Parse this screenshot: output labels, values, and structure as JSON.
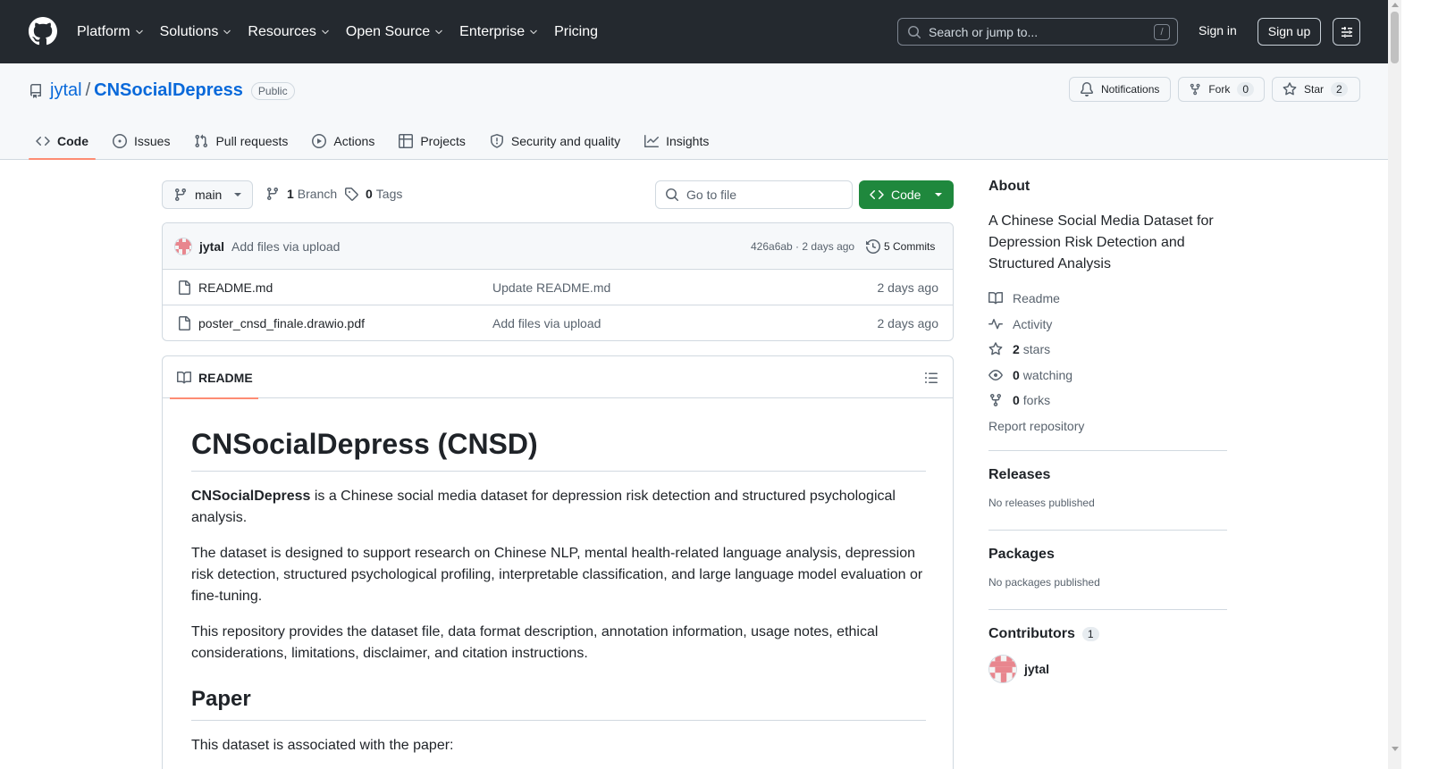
{
  "header": {
    "nav": [
      "Platform",
      "Solutions",
      "Resources",
      "Open Source",
      "Enterprise",
      "Pricing"
    ],
    "search_placeholder": "Search or jump to...",
    "search_shortcut": "/",
    "signin": "Sign in",
    "signup": "Sign up"
  },
  "repo": {
    "owner": "jytal",
    "separator": "/",
    "name": "CNSocialDepress",
    "visibility": "Public",
    "notifications": "Notifications",
    "fork_label": "Fork",
    "fork_count": "0",
    "star_label": "Star",
    "star_count": "2"
  },
  "tabs": [
    "Code",
    "Issues",
    "Pull requests",
    "Actions",
    "Projects",
    "Security and quality",
    "Insights"
  ],
  "toolbar": {
    "branch": "main",
    "branch_count": "1",
    "branch_label": "Branch",
    "tag_count": "0",
    "tag_label": "Tags",
    "goto_placeholder": "Go to file",
    "code_button": "Code"
  },
  "commit": {
    "author": "jytal",
    "message": "Add files via upload",
    "hash_time": "426a6ab · 2 days ago",
    "commits": "5 Commits"
  },
  "files": [
    {
      "name": "README.md",
      "message": "Update README.md",
      "date": "2 days ago"
    },
    {
      "name": "poster_cnsd_finale.drawio.pdf",
      "message": "Add files via upload",
      "date": "2 days ago"
    }
  ],
  "readme": {
    "tab": "README",
    "title": "CNSocialDepress (CNSD)",
    "p1_bold": "CNSocialDepress",
    "p1_rest": " is a Chinese social media dataset for depression risk detection and structured psychological analysis.",
    "p2": "The dataset is designed to support research on Chinese NLP, mental health-related language analysis, depression risk detection, structured psychological profiling, interpretable classification, and large language model evaluation or fine-tuning.",
    "p3": "This repository provides the dataset file, data format description, annotation information, usage notes, ethical considerations, limitations, disclaimer, and citation instructions.",
    "h2": "Paper",
    "p4": "This dataset is associated with the paper:"
  },
  "about": {
    "title": "About",
    "description": "A Chinese Social Media Dataset for Depression Risk Detection and Structured Analysis",
    "readme": "Readme",
    "activity": "Activity",
    "stars_count": "2",
    "stars_label": "stars",
    "watching_count": "0",
    "watching_label": "watching",
    "forks_count": "0",
    "forks_label": "forks",
    "report": "Report repository"
  },
  "releases": {
    "title": "Releases",
    "text": "No releases published"
  },
  "packages": {
    "title": "Packages",
    "text": "No packages published"
  },
  "contributors": {
    "title": "Contributors",
    "count": "1",
    "name": "jytal"
  },
  "colors": {
    "header_bg": "#24292f",
    "accent": "#0969da",
    "code_button": "#1f883d",
    "tab_underline": "#fd8c73"
  }
}
